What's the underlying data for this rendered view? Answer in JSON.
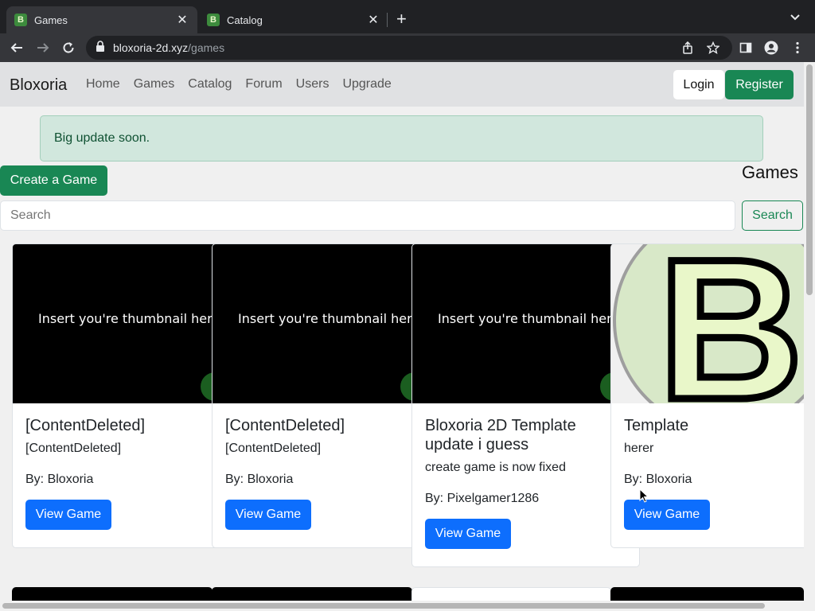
{
  "browser": {
    "tabs": [
      {
        "title": "Games",
        "favicon": "B",
        "active": true
      },
      {
        "title": "Catalog",
        "favicon": "B",
        "active": false
      }
    ],
    "url_host": "bloxoria-2d.xyz",
    "url_path": "/games"
  },
  "navbar": {
    "brand": "Bloxoria",
    "links": [
      "Home",
      "Games",
      "Catalog",
      "Forum",
      "Users",
      "Upgrade"
    ],
    "login": "Login",
    "register": "Register"
  },
  "alert": "Big update soon.",
  "create_button": "Create a Game",
  "heading": "Games",
  "search": {
    "placeholder": "Search",
    "button": "Search"
  },
  "cards": [
    {
      "thumb_text": "Insert you're thumbnail here",
      "title": "[ContentDeleted]",
      "description": "[ContentDeleted]",
      "by": "By: Bloxoria",
      "button": "View Game"
    },
    {
      "thumb_text": "Insert you're thumbnail here",
      "title": "[ContentDeleted]",
      "description": "[ContentDeleted]",
      "by": "By: Bloxoria",
      "button": "View Game"
    },
    {
      "thumb_text": "Insert you're thumbnail here",
      "title": "Bloxoria 2D Template update i guess",
      "description": "create game is now fixed",
      "by": "By: Pixelgamer1286",
      "button": "View Game"
    },
    {
      "thumb_letter": "B",
      "title": "Template",
      "description": "herer",
      "by": "By: Bloxoria",
      "button": "View Game"
    }
  ],
  "colors": {
    "success": "#198754",
    "primary": "#0d6efd",
    "alert_bg": "#d1e7dd",
    "navbar_bg": "#e0e1e3",
    "logo_green": "#e9f7c9"
  }
}
